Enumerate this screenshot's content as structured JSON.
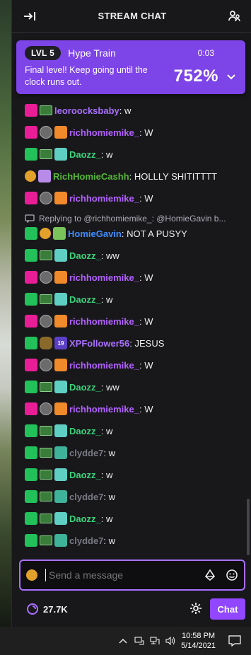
{
  "header": {
    "title": "STREAM CHAT"
  },
  "hype_train": {
    "level": "LVL 5",
    "name": "Hype Train",
    "timer": "0:03",
    "description": "Final level! Keep going until the clock runs out.",
    "percent": "752%"
  },
  "messages": [
    {
      "user": "leoroocksbaby",
      "text": ": w"
    },
    {
      "user": "richhomiemike_",
      "text": ": W"
    },
    {
      "user": "Daozz_",
      "text": ": w"
    },
    {
      "user": "RichHomieCashh",
      "text": ": HOLLLY SHITITTTT"
    },
    {
      "user": "richhomiemike_",
      "text": ": W"
    },
    {
      "user": "HomieGavin",
      "text": ": NOT A PUSYY"
    },
    {
      "user": "Daozz_",
      "text": ": ww"
    },
    {
      "user": "richhomiemike_",
      "text": ": W"
    },
    {
      "user": "Daozz_",
      "text": ": w"
    },
    {
      "user": "richhomiemike_",
      "text": ": W"
    },
    {
      "user": "XPFollower56",
      "text": ": JESUS"
    },
    {
      "user": "richhomiemike_",
      "text": ": W"
    },
    {
      "user": "Daozz_",
      "text": ": ww"
    },
    {
      "user": "richhomiemike_",
      "text": ": W"
    },
    {
      "user": "Daozz_",
      "text": ": w"
    },
    {
      "user": "clydde7",
      "text": ": w"
    },
    {
      "user": "Daozz_",
      "text": ": w"
    },
    {
      "user": "clydde7",
      "text": ": w"
    },
    {
      "user": "Daozz_",
      "text": ": w"
    },
    {
      "user": "clydde7",
      "text": ": w"
    }
  ],
  "reply": {
    "text": "Replying to @richhomiemike_: @HomieGavin b..."
  },
  "input": {
    "placeholder": "Send a message"
  },
  "footer": {
    "points": "27.7K",
    "chat_button": "Chat"
  },
  "taskbar": {
    "time": "10:58 PM",
    "date": "5/14/2021"
  }
}
